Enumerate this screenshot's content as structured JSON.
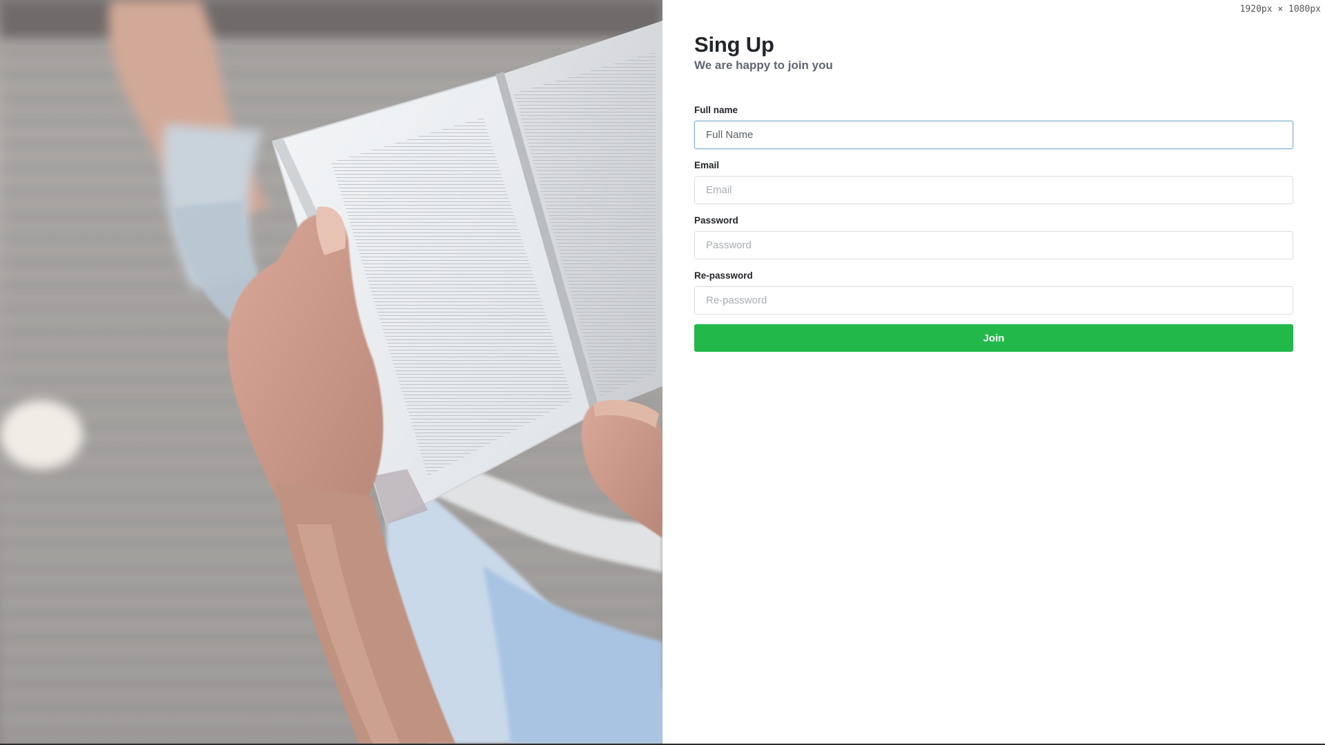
{
  "window": {
    "size_readout": "1920px × 1080px"
  },
  "hero": {
    "image": "person-reading-book-photo"
  },
  "signup": {
    "title": "Sing Up",
    "subtitle": "We are happy to join you",
    "fields": [
      {
        "label": "Full name",
        "placeholder": "Full Name",
        "value": "",
        "focused": true
      },
      {
        "label": "Email",
        "placeholder": "Email",
        "value": ""
      },
      {
        "label": "Password",
        "placeholder": "Password",
        "value": ""
      },
      {
        "label": "Re-password",
        "placeholder": "Re-password",
        "value": ""
      }
    ],
    "submit_label": "Join"
  },
  "colors": {
    "accent_button": "#22b84a",
    "focus_border": "#7fb3cf",
    "title_text": "#222529",
    "subtitle_text": "#5f6670"
  }
}
